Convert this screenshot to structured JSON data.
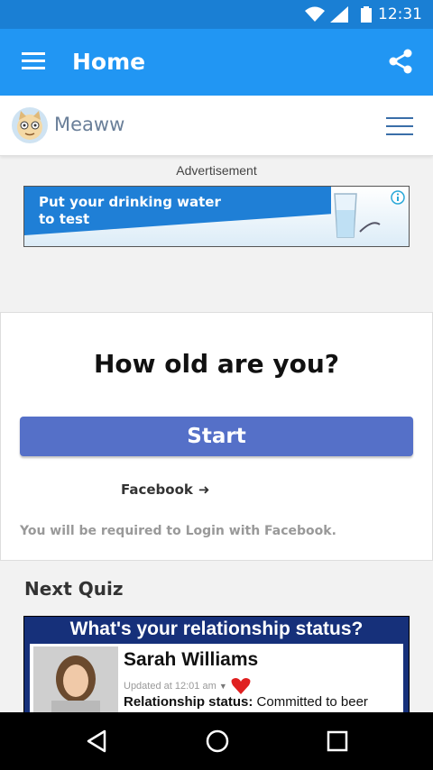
{
  "status_bar": {
    "time": "12:31",
    "icons": [
      "wifi-icon",
      "signal-icon",
      "battery-icon"
    ]
  },
  "app_bar": {
    "title": "Home",
    "menu_icon": "menu-icon",
    "share_icon": "share-icon"
  },
  "site_bar": {
    "brand": "Meaww",
    "logo_icon": "cat-logo",
    "menu_icon": "hamburger-icon"
  },
  "ad": {
    "label": "Advertisement",
    "line1": "Put your drinking water",
    "line2": "to test"
  },
  "quiz_card": {
    "question": "How old are you?",
    "start_label": "Start",
    "facebook_label": "Facebook",
    "facebook_arrow": "➜",
    "login_note": "You will be required to Login with Facebook."
  },
  "next_quiz": {
    "heading": "Next Quiz",
    "image_title": "What's your relationship status?",
    "profile_name": "Sarah Williams",
    "updated": "Updated at 12:01 am",
    "relationship_label": "Relationship status:",
    "relationship_value": "Committed to beer"
  },
  "nav_bar": {
    "buttons": [
      "back-icon",
      "home-icon",
      "recents-icon"
    ]
  },
  "colors": {
    "status_bar": "#1a7fd4",
    "app_bar": "#2196f3",
    "start_button": "#5570c8",
    "quiz_banner": "#16307a"
  }
}
